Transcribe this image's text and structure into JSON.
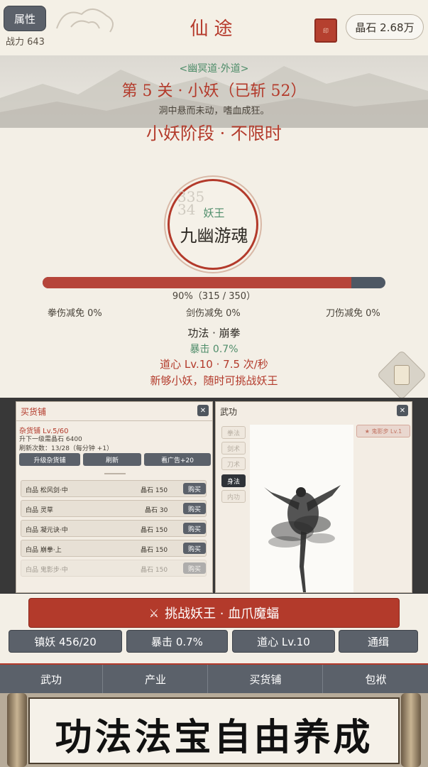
{
  "header": {
    "attr_label": "属性",
    "power": "战力 643",
    "title": "仙途",
    "seal_text": "印",
    "crystal": "晶石 2.68万"
  },
  "stage": {
    "region": "<幽冥道·外道>",
    "level_title": "第 5 关 · 小妖（已斩 52）",
    "level_desc": "洞中悬而未动，嗜血成狂。",
    "phase": "小妖阶段 · 不限时"
  },
  "boss": {
    "damage_numbers": "335\n34",
    "tag": "妖王",
    "name": "九幽游魂",
    "hp_fraction": 0.9,
    "hp_text": "90%（315 / 350）",
    "resist_fist": "拳伤减免 0%",
    "resist_sword": "剑伤减免 0%",
    "resist_blade": "刀伤减免 0%"
  },
  "combat": {
    "skill": "功法 · 崩拳",
    "crit": "暴击 0.7%",
    "dao": "道心 Lv.10 · 7.5 次/秒",
    "hint": "新够小妖，随时可挑战妖王"
  },
  "shop_panel": {
    "title": "买货铺",
    "close": "✕",
    "level": "杂货铺 Lv.5/60",
    "next": "升下一级需晶石 6400",
    "refresh": "刷新次数：13/28（每分钟 +1）",
    "btn_upgrade": "升级杂货铺",
    "btn_refresh": "刷新",
    "btn_ad": "看广告+20",
    "items": [
      {
        "name": "白品 松风剑·中",
        "price": "晶石 150",
        "buy": "购买"
      },
      {
        "name": "白品 灵草",
        "price": "晶石 30",
        "buy": "购买"
      },
      {
        "name": "白品 凝元诀·中",
        "price": "晶石 150",
        "buy": "购买"
      },
      {
        "name": "白品 崩拳·上",
        "price": "晶石 150",
        "buy": "购买"
      },
      {
        "name": "白品 鬼影步·中",
        "price": "晶石 150",
        "buy": "购买"
      }
    ]
  },
  "martial_panel": {
    "title": "武功",
    "close": "✕",
    "tabs": [
      "拳法",
      "剑术",
      "刀术",
      "身法",
      "内功"
    ],
    "active_tab": 3,
    "skill_tag": "★ 鬼影步 Lv.1"
  },
  "actions": {
    "challenge": "挑战妖王 · 血爪魔蝠",
    "challenge_icon": "crossed-swords-icon",
    "seal_count": "镇妖 456/20",
    "crit": "暴击 0.7%",
    "dao": "道心 Lv.10",
    "wanted": "通缉"
  },
  "nav": {
    "martial": "武功",
    "industry": "产业",
    "shop": "买货铺",
    "bag": "包袱"
  },
  "promo": {
    "text": "功法法宝自由养成"
  },
  "colors": {
    "accent_red": "#b33a2b",
    "accent_green": "#4f8d6a",
    "button_gray": "#5b616a",
    "paper": "#f3efe6"
  }
}
